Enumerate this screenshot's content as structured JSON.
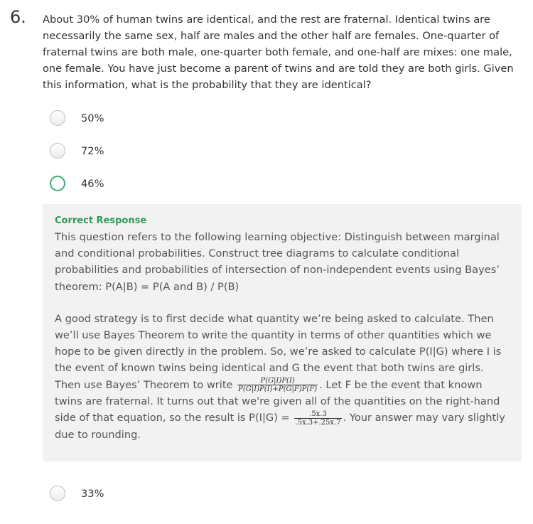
{
  "question": {
    "number": "6.",
    "text": "About 30% of human twins are identical, and the rest are fraternal. Identical twins are necessarily the same sex, half are males and the other half are females. One-quarter of fraternal twins are both male, one-quarter both female, and one-half are mixes: one male, one female. You have just become a parent of twins and are told they are both girls. Given this information, what is the probability that they are identical?"
  },
  "options": [
    {
      "label": "50%",
      "state": "unselected"
    },
    {
      "label": "72%",
      "state": "unselected"
    },
    {
      "label": "46%",
      "state": "correct"
    },
    {
      "label": "33%",
      "state": "unselected"
    }
  ],
  "feedback": {
    "title": "Correct Response",
    "paragraph1": "This question refers to the following learning objective: Distinguish between marginal and conditional probabilities. Construct tree diagrams to calculate conditional probabilities and probabilities of intersection of non-independent events using Bayes’ theorem: P(A|B) = P(A and B) / P(B)",
    "p2_part1": "A good strategy is to first decide what quantity we’re being asked to calculate. Then we’ll use Bayes Theorem to write the quantity in terms of other quantities which we hope to be given directly in the problem. So, we’re asked to calculate P(I|G) where I is the event of known twins being identical and G the event that both twins are girls. Then use Bayes’ Theorem to write ",
    "formula1_num": "P(G|I)P(I)",
    "formula1_den": "P(G|I)P(I)+P(G|F)P(F)",
    "p2_part2": ". Let F be the event that known twins are fraternal. It turns out that we're given all of the quantities on the right-hand side of that equation, so the result is P(I|G) = ",
    "formula2_num": ".5x.3",
    "formula2_den": ".5x.3+.25x.7",
    "p2_part3": ". Your answer may vary slightly due to rounding."
  },
  "colors": {
    "correct_green": "#3dad6a",
    "feedback_bg": "#f2f2f2",
    "feedback_title": "#2f9a55"
  }
}
